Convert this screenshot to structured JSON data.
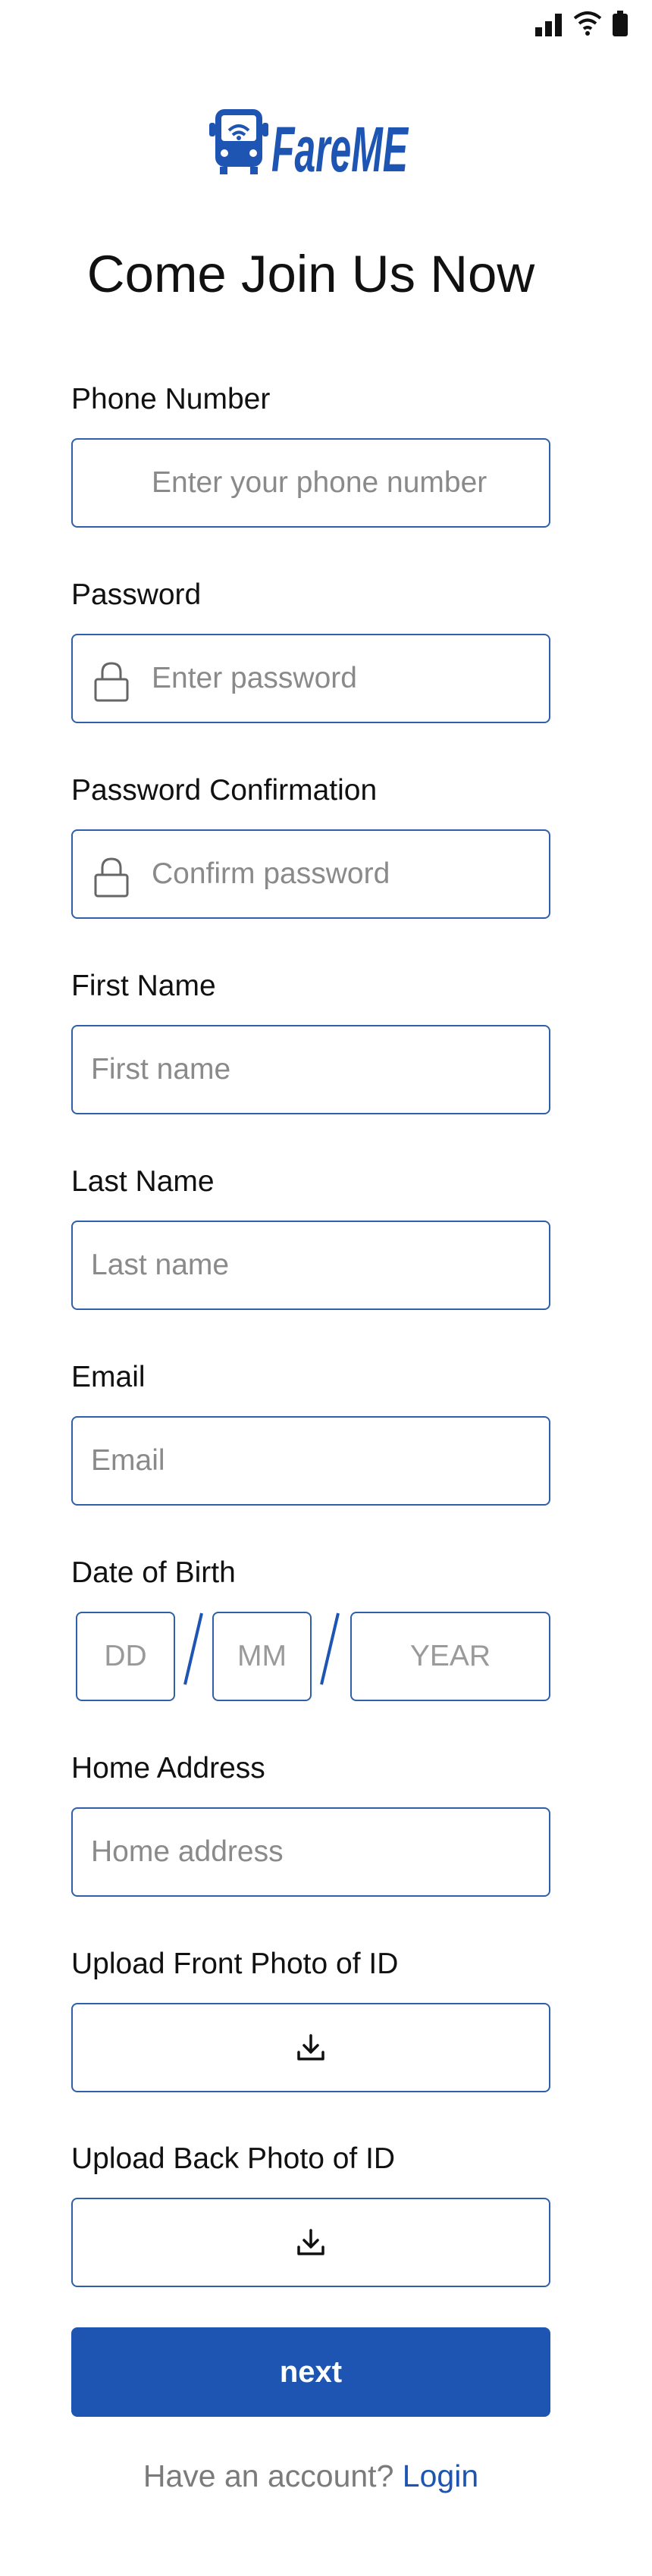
{
  "status_bar": {
    "icons": [
      "signal-icon",
      "wifi-icon",
      "battery-icon"
    ]
  },
  "brand": {
    "logo_text": "FareME",
    "logo_icon": "bus-wifi-icon",
    "primary_color": "#1e55b3",
    "border_color": "#2f5fa8"
  },
  "title": "Come Join Us Now",
  "fields": {
    "phone": {
      "label": "Phone Number",
      "placeholder": "Enter your phone number",
      "value": ""
    },
    "password": {
      "label": "Password",
      "placeholder": "Enter password",
      "icon": "lock-icon",
      "value": ""
    },
    "password_confirmation": {
      "label": "Password Confirmation",
      "placeholder": "Confirm password",
      "icon": "lock-icon",
      "value": ""
    },
    "first_name": {
      "label": "First Name",
      "placeholder": "First name",
      "value": ""
    },
    "last_name": {
      "label": "Last Name",
      "placeholder": "Last name",
      "value": ""
    },
    "email": {
      "label": "Email",
      "placeholder": "Email",
      "value": ""
    },
    "dob": {
      "label": "Date of Birth",
      "day_placeholder": "DD",
      "month_placeholder": "MM",
      "year_placeholder": "YEAR",
      "separator": "/"
    },
    "home_address": {
      "label": "Home Address",
      "placeholder": "Home address",
      "value": ""
    },
    "id_front": {
      "label": "Upload Front Photo of ID",
      "icon": "download-icon"
    },
    "id_back": {
      "label": "Upload Back Photo of ID",
      "icon": "download-icon"
    }
  },
  "next_button": {
    "label": "next"
  },
  "footer": {
    "prompt": "Have an account?",
    "link": "Login"
  }
}
